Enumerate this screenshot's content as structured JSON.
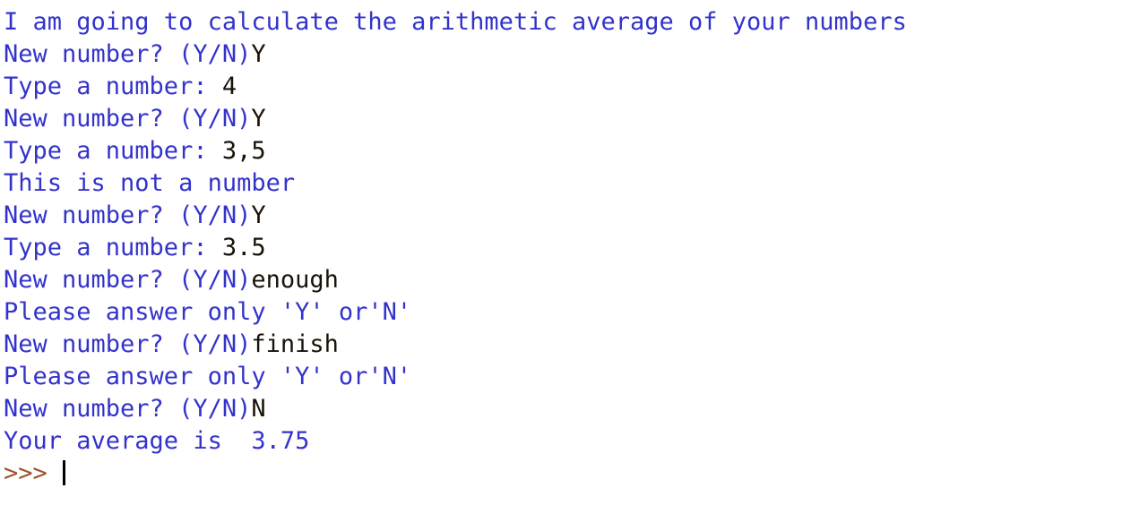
{
  "window": {
    "title": "Python Shell",
    "background_color": "#ffffff"
  },
  "colors": {
    "stdout": "#3333cc",
    "stdin": "#1a1208",
    "prompt": "#a0522d",
    "caret": "#000000"
  },
  "console": {
    "prompt_symbol": ">>> ",
    "lines": [
      {
        "id": "line-1",
        "segments": [
          {
            "kind": "stdout",
            "text": "I am going to calculate the arithmetic average of your numbers"
          }
        ]
      },
      {
        "id": "line-2",
        "segments": [
          {
            "kind": "stdout",
            "text": "New number? (Y/N)"
          },
          {
            "kind": "stdin",
            "text": "Y"
          }
        ]
      },
      {
        "id": "line-3",
        "segments": [
          {
            "kind": "stdout",
            "text": "Type a number: "
          },
          {
            "kind": "stdin",
            "text": "4"
          }
        ]
      },
      {
        "id": "line-4",
        "segments": [
          {
            "kind": "stdout",
            "text": "New number? (Y/N)"
          },
          {
            "kind": "stdin",
            "text": "Y"
          }
        ]
      },
      {
        "id": "line-5",
        "segments": [
          {
            "kind": "stdout",
            "text": "Type a number: "
          },
          {
            "kind": "stdin",
            "text": "3,5"
          }
        ]
      },
      {
        "id": "line-6",
        "segments": [
          {
            "kind": "stdout",
            "text": "This is not a number"
          }
        ]
      },
      {
        "id": "line-7",
        "segments": [
          {
            "kind": "stdout",
            "text": "New number? (Y/N)"
          },
          {
            "kind": "stdin",
            "text": "Y"
          }
        ]
      },
      {
        "id": "line-8",
        "segments": [
          {
            "kind": "stdout",
            "text": "Type a number: "
          },
          {
            "kind": "stdin",
            "text": "3.5"
          }
        ]
      },
      {
        "id": "line-9",
        "segments": [
          {
            "kind": "stdout",
            "text": "New number? (Y/N)"
          },
          {
            "kind": "stdin",
            "text": "enough"
          }
        ]
      },
      {
        "id": "line-10",
        "segments": [
          {
            "kind": "stdout",
            "text": "Please answer only 'Y' or'N'"
          }
        ]
      },
      {
        "id": "line-11",
        "segments": [
          {
            "kind": "stdout",
            "text": "New number? (Y/N)"
          },
          {
            "kind": "stdin",
            "text": "finish"
          }
        ]
      },
      {
        "id": "line-12",
        "segments": [
          {
            "kind": "stdout",
            "text": "Please answer only 'Y' or'N'"
          }
        ]
      },
      {
        "id": "line-13",
        "segments": [
          {
            "kind": "stdout",
            "text": "New number? (Y/N)"
          },
          {
            "kind": "stdin",
            "text": "N"
          }
        ]
      },
      {
        "id": "line-14",
        "segments": [
          {
            "kind": "stdout",
            "text": "Your average is  3.75"
          }
        ]
      },
      {
        "id": "line-15",
        "segments": [
          {
            "kind": "prompt",
            "text": ">>> "
          }
        ],
        "caret": true
      }
    ]
  }
}
